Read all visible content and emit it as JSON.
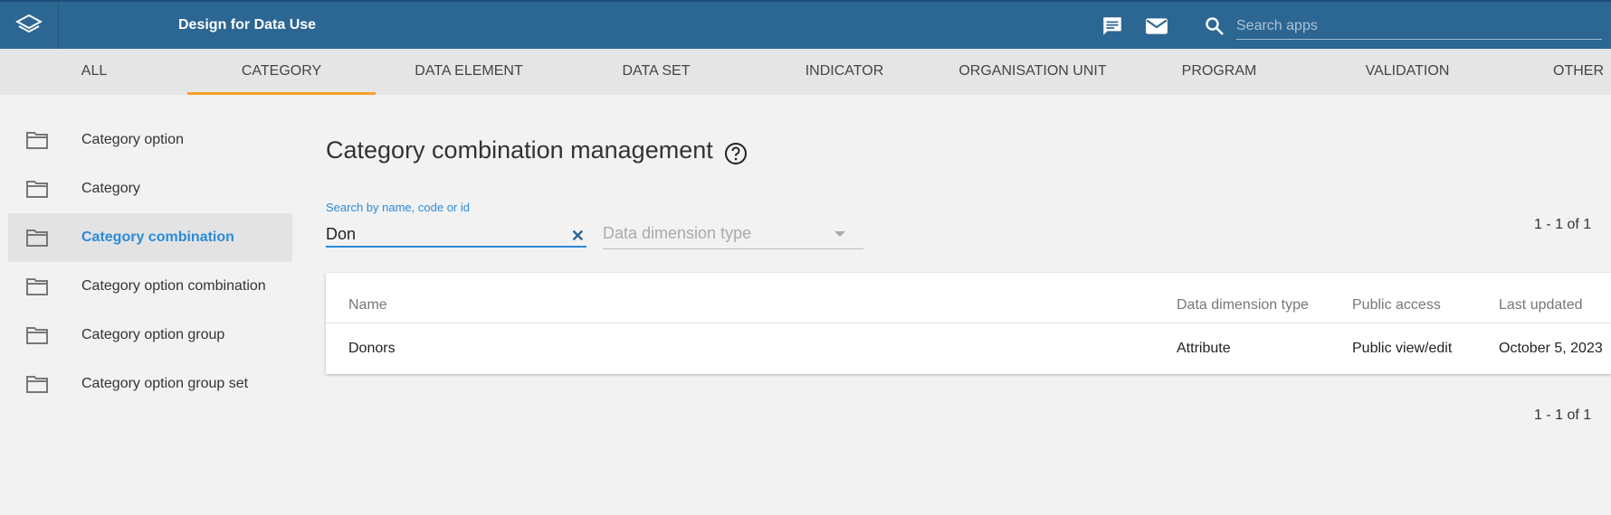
{
  "header": {
    "app_title": "Design for Data Use",
    "search_placeholder": "Search apps",
    "icons": [
      "logo-icon",
      "message-icon",
      "mail-icon",
      "search-icon"
    ]
  },
  "tabs": [
    {
      "label": "ALL",
      "active": false
    },
    {
      "label": "CATEGORY",
      "active": true
    },
    {
      "label": "DATA ELEMENT",
      "active": false
    },
    {
      "label": "DATA SET",
      "active": false
    },
    {
      "label": "INDICATOR",
      "active": false
    },
    {
      "label": "ORGANISATION UNIT",
      "active": false
    },
    {
      "label": "PROGRAM",
      "active": false
    },
    {
      "label": "VALIDATION",
      "active": false
    },
    {
      "label": "OTHER",
      "active": false
    }
  ],
  "sidebar": {
    "items": [
      {
        "label": "Category option",
        "active": false
      },
      {
        "label": "Category",
        "active": false
      },
      {
        "label": "Category combination",
        "active": true
      },
      {
        "label": "Category option combination",
        "active": false
      },
      {
        "label": "Category option group",
        "active": false
      },
      {
        "label": "Category option group set",
        "active": false
      }
    ]
  },
  "main": {
    "title": "Category combination management",
    "search": {
      "label": "Search by name, code or id",
      "value": "Don",
      "clear_symbol": "✕"
    },
    "dimension_filter": {
      "placeholder": "Data dimension type"
    },
    "pager_top": "1 - 1 of 1",
    "pager_bottom": "1 - 1 of 1",
    "table": {
      "columns": [
        "Name",
        "Data dimension type",
        "Public access",
        "Last updated"
      ],
      "rows": [
        [
          "Donors",
          "Attribute",
          "Public view/edit",
          "October 5, 2023"
        ]
      ]
    }
  },
  "colors": {
    "header_bg": "#2c6693",
    "tab_bg": "#e5e5e5",
    "tab_active_underline": "#f99f29",
    "accent_blue": "#2a8bd9",
    "page_bg": "#f2f2f2"
  }
}
